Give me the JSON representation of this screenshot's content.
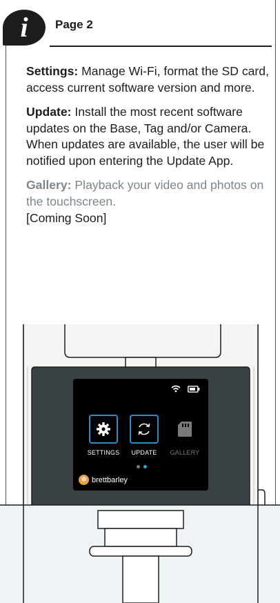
{
  "header": {
    "badge_glyph": "i",
    "title": "Page 2"
  },
  "sections": [
    {
      "term": "Settings:",
      "text": " Manage Wi-Fi, format the SD card, access current software version and more."
    },
    {
      "term": "Update:",
      "text": " Install the most recent software updates on the Base, Tag and/or Camera. When updates are available, the user will be notified upon entering the Update App."
    },
    {
      "term": "Gallery:",
      "text": " Playback your video and photos on the touchscreen.",
      "note": "[Coming Soon]"
    }
  ],
  "device_screen": {
    "apps": [
      {
        "label": "SETTINGS",
        "icon": "gear-icon",
        "state": "active"
      },
      {
        "label": "UPDATE",
        "icon": "refresh-icon",
        "state": "active"
      },
      {
        "label": "GALLERY",
        "icon": "sd-card-icon",
        "state": "disabled"
      }
    ],
    "page_indicator": {
      "current": 2,
      "total": 2
    },
    "username": "brettbarley",
    "status_icons": [
      "wifi-icon",
      "battery-icon"
    ]
  },
  "colors": {
    "text": "#1d1d1b",
    "muted": "#7c868a",
    "accent": "#2ba4e0",
    "device_body": "#f2f2f2",
    "device_bezel": "#3a4145"
  }
}
